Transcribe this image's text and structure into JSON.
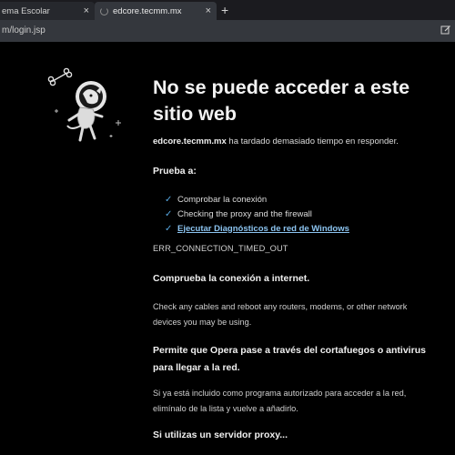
{
  "tabs": [
    {
      "title": "ema Escolar",
      "close": "×"
    },
    {
      "title": "edcore.tecmm.mx",
      "close": "×"
    }
  ],
  "new_tab": "+",
  "address_bar": {
    "url": "m/login.jsp"
  },
  "page": {
    "title": "No se puede acceder a este sitio web",
    "intro_host": "edcore.tecmm.mx",
    "intro_rest": " ha tardado demasiado tiempo en responder.",
    "try_heading": "Prueba a:",
    "suggestions": [
      "Comprobar la conexión",
      "Checking the proxy and the firewall",
      "Ejecutar Diagnósticos de red de Windows"
    ],
    "error_code": "ERR_CONNECTION_TIMED_OUT",
    "section1_heading": "Comprueba la conexión a internet.",
    "section1_text": "Check any cables and reboot any routers, modems, or other network devices you may be using.",
    "section2_heading": "Permite que Opera pase a través del cortafuegos o antivirus para llegar a la red.",
    "section2_text": "Si ya está incluido como programa autorizado para acceder a la red, elimínalo de la lista y vuelve a añadirlo.",
    "section3_heading": "Si utilizas un servidor proxy..."
  },
  "colors": {
    "accent": "#57a7e0",
    "link": "#8cc4f0",
    "background": "#000000"
  }
}
